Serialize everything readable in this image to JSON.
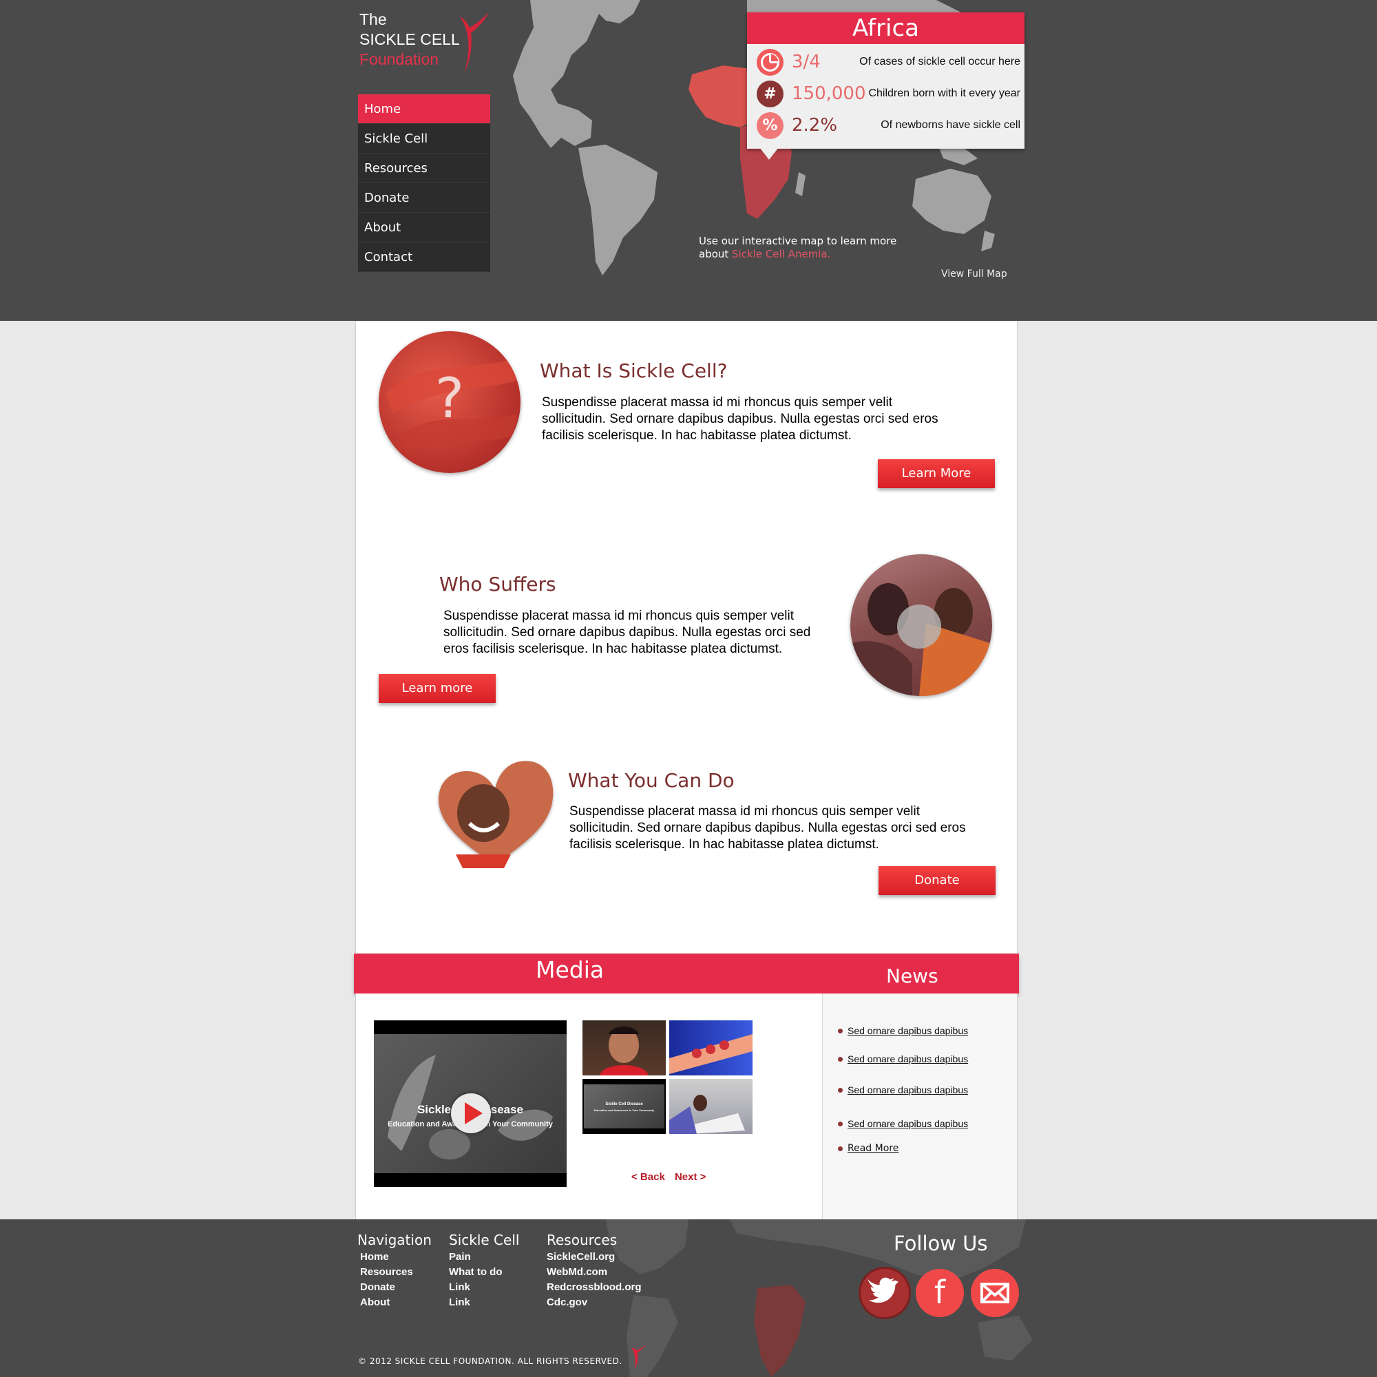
{
  "logo": {
    "line1": "The",
    "line2": "SICKLE CELL",
    "line3": "Foundation"
  },
  "nav": {
    "items": [
      "Home",
      "Sickle Cell",
      "Resources",
      "Donate",
      "About",
      "Contact"
    ]
  },
  "popup": {
    "region": "Africa",
    "stats": [
      {
        "icon": "pie-chart-icon",
        "value": "3/4",
        "label": "Of cases of sickle cell occur here"
      },
      {
        "icon": "hash-icon",
        "value": "150,000",
        "label": "Children born with it every year"
      },
      {
        "icon": "percent-icon",
        "value": "2.2%",
        "label": "Of newborns have sickle cell"
      }
    ]
  },
  "map_caption": {
    "line1": "Use our interactive map to learn more",
    "line2_prefix": "about ",
    "line2_link": "Sickle Cell Anemia."
  },
  "view_full_map": "View Full Map",
  "sections": [
    {
      "title": "What Is Sickle Cell?",
      "body": "Suspendisse placerat massa id mi rhoncus quis semper velit sollicitudin. Sed ornare dapibus dapibus. Nulla egestas orci sed eros facilisis scelerisque. In hac habitasse platea dictumst.",
      "button": "Learn More",
      "image_glyph": "?"
    },
    {
      "title": "Who Suffers",
      "body": "Suspendisse placerat massa id mi rhoncus quis semper velit sollicitudin. Sed ornare dapibus dapibus. Nulla egestas orci sed eros facilisis scelerisque. In hac habitasse platea dictumst.",
      "button": "Learn more"
    },
    {
      "title": "What You Can Do",
      "body": "Suspendisse placerat massa id mi rhoncus quis semper velit sollicitudin. Sed ornare dapibus dapibus. Nulla egestas orci sed eros facilisis scelerisque. In hac habitasse platea dictumst.",
      "button": "Donate"
    }
  ],
  "media": {
    "title": "Media",
    "video_title": "Sickle Cell Disease",
    "video_subtitle": "Education and Awareness in Your Community",
    "thumb_title": "Sickle Cell Disease",
    "thumb_subtitle": "Education and Awareness in Your Community",
    "back": "< Back",
    "next": "Next >"
  },
  "news": {
    "title": "News",
    "items": [
      "Sed ornare dapibus dapibus",
      "Sed ornare dapibus dapibus",
      "Sed ornare dapibus dapibus",
      "Sed ornare dapibus dapibus"
    ],
    "read_more": "Read More"
  },
  "footer": {
    "nav": {
      "heading": "Navigation",
      "links": [
        "Home",
        "Resources",
        "Donate",
        "About"
      ]
    },
    "sickle": {
      "heading": "Sickle Cell",
      "links": [
        "Pain",
        "What to do",
        "Link",
        "Link"
      ]
    },
    "resources": {
      "heading": "Resources",
      "links": [
        "SickleCell.org",
        "WebMd.com",
        "Redcrossblood.org",
        "Cdc.gov"
      ]
    },
    "follow": "Follow Us",
    "copyright": "© 2012 SICKLE CELL FOUNDATION. ALL RIGHTS RESERVED."
  },
  "colors": {
    "accent": "#e42c4a",
    "dark": "#4a4a4a",
    "button": "#e8262e",
    "heading": "#7a2e2e"
  }
}
